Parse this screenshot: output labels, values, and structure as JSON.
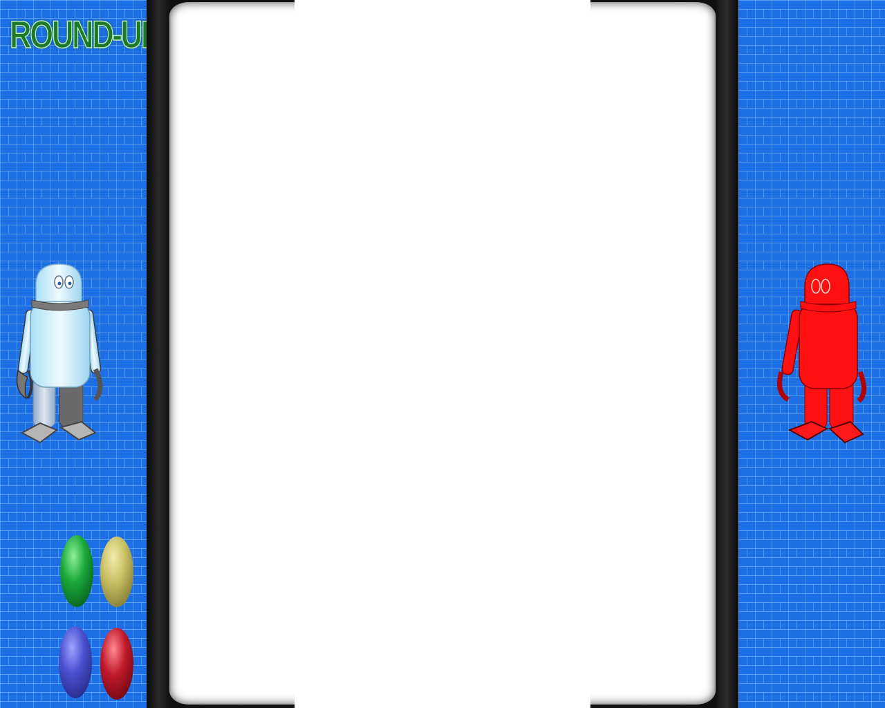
{
  "game": {
    "title": "ROUND-UP"
  },
  "players": [
    {
      "name_icon": "robot-icon",
      "color": "#cfeefc"
    },
    {
      "name_icon": "robot-icon",
      "color": "#ff1010"
    }
  ],
  "gems": [
    {
      "icon": "green-gem-icon",
      "color": "#1aa83a"
    },
    {
      "icon": "yellow-gem-icon",
      "color": "#c8bf62"
    },
    {
      "icon": "blue-gem-icon",
      "color": "#4a4fd0"
    },
    {
      "icon": "red-gem-icon",
      "color": "#c01a2a"
    }
  ],
  "colors": {
    "background": "#1d6fe6",
    "frame": "#151515",
    "screen": "#ffffff"
  }
}
